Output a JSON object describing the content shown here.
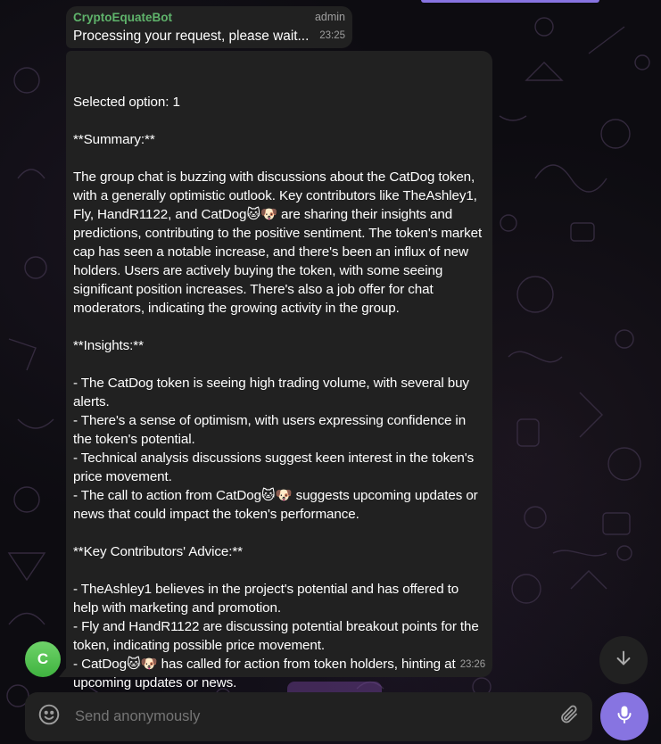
{
  "message_header": {
    "sender": "CryptoEquateBot",
    "role": "admin",
    "text": "Processing your request, please wait...",
    "time": "23:25"
  },
  "main_message": {
    "text": "Selected option: 1\n\n**Summary:**\n\nThe group chat is buzzing with discussions about the CatDog token, with a generally optimistic outlook. Key contributors like TheAshley1, Fly, HandR1122, and CatDog🐱🐶 are sharing their insights and predictions, contributing to the positive sentiment. The token's market cap has seen a notable increase, and there's been an influx of new holders. Users are actively buying the token, with some seeing significant position increases. There's also a job offer for chat moderators, indicating the growing activity in the group.\n\n**Insights:**\n\n- The CatDog token is seeing high trading volume, with several buy alerts.\n- There's a sense of optimism, with users expressing confidence in the token's potential.\n- Technical analysis discussions suggest keen interest in the token's price movement.\n- The call to action from CatDog🐱🐶 suggests upcoming updates or news that could impact the token's performance.\n\n**Key Contributors' Advice:**\n\n- TheAshley1 believes in the project's potential and has offered to help with marketing and promotion.\n- Fly and HandR1122 are discussing potential breakout points for the token, indicating possible price movement.\n- CatDog🐱🐶 has called for action from token holders, hinting at upcoming updates or news.",
    "time": "23:26"
  },
  "avatar": {
    "initial": "C",
    "color": "#4cc04a"
  },
  "composer": {
    "placeholder": "Send anonymously"
  },
  "icons": {
    "emoji": "smiley-icon",
    "attach": "paperclip-icon",
    "mic": "microphone-icon",
    "scroll": "arrow-down-icon"
  },
  "colors": {
    "accent": "#8774e1",
    "bubble": "#212121",
    "sender": "#5fb36b"
  }
}
